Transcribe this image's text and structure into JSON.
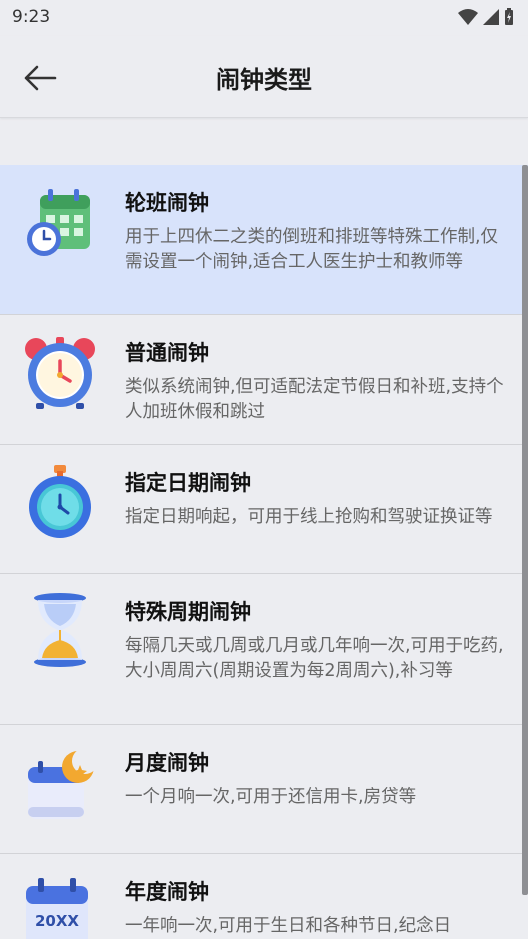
{
  "status": {
    "time": "9:23"
  },
  "header": {
    "title": "闹钟类型"
  },
  "items": [
    {
      "title": "轮班闹钟",
      "desc": "用于上四休二之类的倒班和排班等特殊工作制,仅需设置一个闹钟,适合工人医生护士和教师等",
      "icon": "shift-calendar-clock-icon"
    },
    {
      "title": "普通闹钟",
      "desc": "类似系统闹钟,但可适配法定节假日和补班,支持个人加班休假和跳过",
      "icon": "alarm-clock-icon"
    },
    {
      "title": "指定日期闹钟",
      "desc": "指定日期响起，可用于线上抢购和驾驶证换证等",
      "icon": "stopwatch-icon"
    },
    {
      "title": "特殊周期闹钟",
      "desc": "每隔几天或几周或几月或几年响一次,可用于吃药,大小周周六(周期设置为每2周周六),补习等",
      "icon": "hourglass-icon"
    },
    {
      "title": "月度闹钟",
      "desc": "一个月响一次,可用于还信用卡,房贷等",
      "icon": "moon-calendar-icon"
    },
    {
      "title": "年度闹钟",
      "desc": "一年响一次,可用于生日和各种节日,纪念日",
      "icon": "yearly-calendar-icon",
      "badge": "20XX"
    }
  ]
}
